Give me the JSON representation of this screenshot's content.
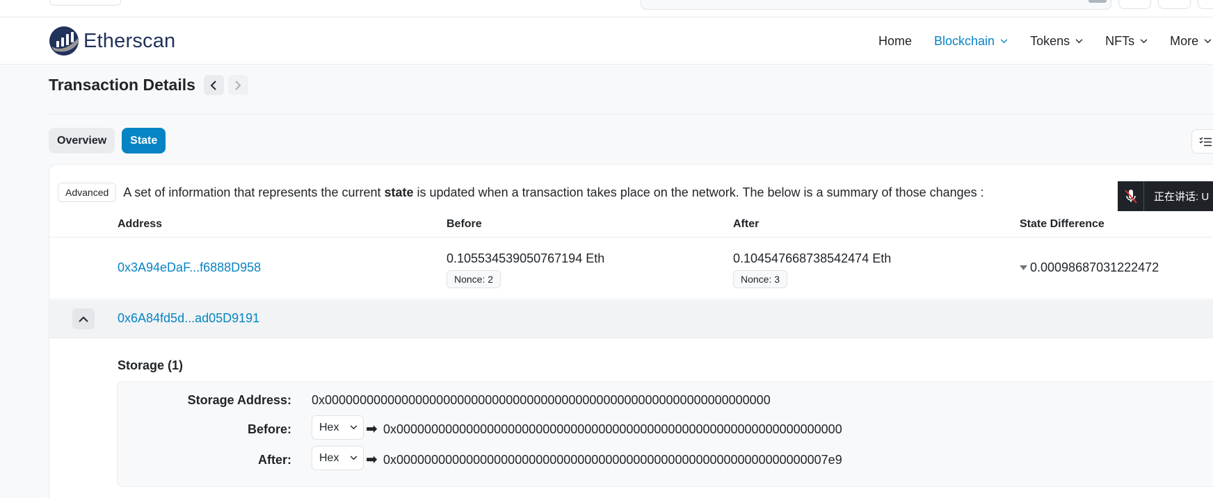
{
  "header": {
    "logo_text": "Etherscan",
    "nav": [
      {
        "label": "Home",
        "has_dropdown": false,
        "active": false
      },
      {
        "label": "Blockchain",
        "has_dropdown": true,
        "active": true
      },
      {
        "label": "Tokens",
        "has_dropdown": true,
        "active": false
      },
      {
        "label": "NFTs",
        "has_dropdown": true,
        "active": false
      },
      {
        "label": "More",
        "has_dropdown": true,
        "active": false
      }
    ]
  },
  "page": {
    "title": "Transaction Details",
    "tabs": [
      {
        "label": "Overview",
        "active": false
      },
      {
        "label": "State",
        "active": true
      }
    ]
  },
  "state": {
    "badge": "Advanced",
    "intro_before": "A set of information that represents the current ",
    "intro_bold": "state",
    "intro_after": " is updated when a transaction takes place on the network. The below is a summary of those changes :",
    "columns": {
      "address": "Address",
      "before": "Before",
      "after": "After",
      "diff": "State Difference"
    },
    "rows": [
      {
        "address": "0x3A94eDaF...f6888D958",
        "before": "0.105534539050767194 Eth",
        "before_nonce": "Nonce: 2",
        "after": "0.104547668738542474 Eth",
        "after_nonce": "Nonce: 3",
        "diff": "0.00098687031222472"
      },
      {
        "address": "0x6A84fd5d...ad05D9191"
      }
    ],
    "storage": {
      "title": "Storage (1)",
      "address_label": "Storage Address:",
      "address_value": "0x0000000000000000000000000000000000000000000000000000000000000000",
      "before_label": "Before:",
      "before_format": "Hex",
      "before_value": "0x0000000000000000000000000000000000000000000000000000000000000000",
      "after_label": "After:",
      "after_format": "Hex",
      "after_value": "0x00000000000000000000000000000000000000000000000000000000000007e9"
    }
  },
  "toast": {
    "text": "正在讲话: U"
  },
  "colors": {
    "accent": "#0784c3",
    "text": "#212529",
    "bg": "#f8f9fa"
  }
}
